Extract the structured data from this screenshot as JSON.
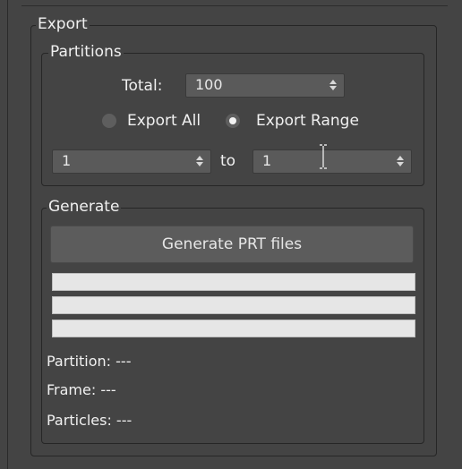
{
  "export_group": {
    "title": "Export",
    "partitions": {
      "title": "Partitions",
      "total_label": "Total:",
      "total_value": "100",
      "radio_export_all": {
        "label": "Export All",
        "checked": false
      },
      "radio_export_range": {
        "label": "Export Range",
        "checked": true
      },
      "range_from_value": "1",
      "range_to_label": "to",
      "range_to_value": "1"
    },
    "generate": {
      "title": "Generate",
      "button_label": "Generate PRT files",
      "progress_bars": [
        {
          "value": 0
        },
        {
          "value": 0
        },
        {
          "value": 0
        }
      ],
      "partition_label": "Partition: ---",
      "frame_label": "Frame: ---",
      "particles_label": "Particles: ---"
    }
  },
  "icons": {
    "spinner_arrows": "up-down-arrows-icon",
    "text_cursor": "i-beam-cursor-icon"
  }
}
